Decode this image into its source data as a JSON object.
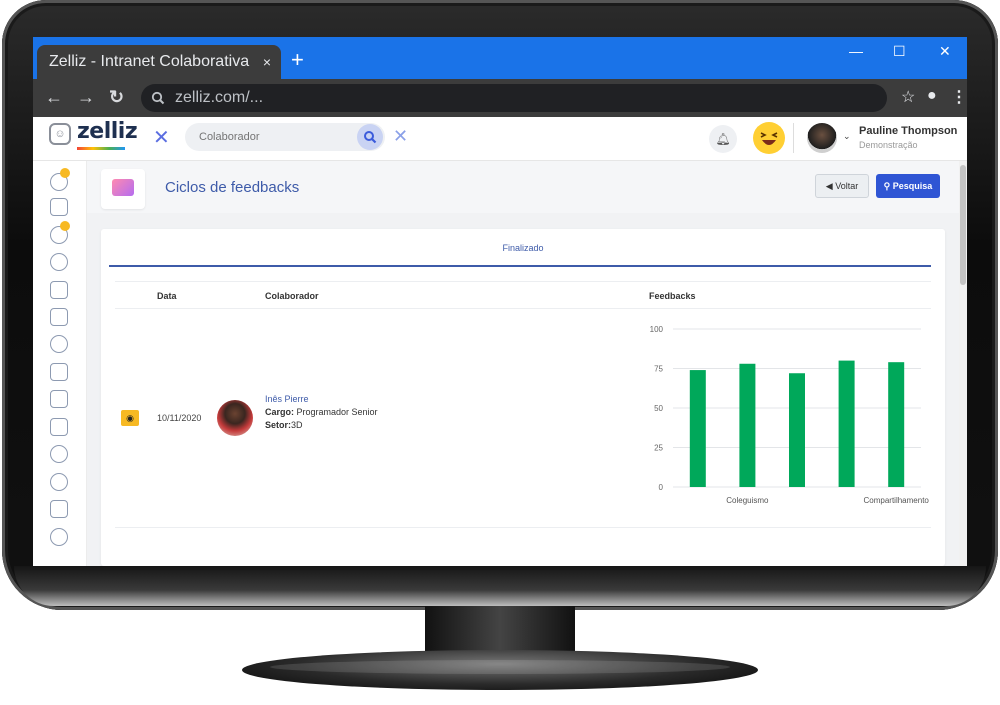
{
  "browser": {
    "tab_title": "Zelliz - Intranet Colaborativa",
    "tab_close": "×",
    "new_tab": "+",
    "url": "zelliz.com/...",
    "window_controls": [
      "—",
      "☐",
      "✕"
    ]
  },
  "app": {
    "logo_text": "zelliz",
    "search_placeholder": "Colaborador",
    "user": {
      "name": "Pauline Thompson",
      "role": "Demonstração"
    }
  },
  "sidebar": {
    "icons": [
      "team-icon",
      "certificate-icon",
      "chat-icon",
      "person-icon",
      "photo-icon",
      "presentation-icon",
      "trophy-icon",
      "book-icon",
      "notes-icon",
      "calendar-icon",
      "gamepad-icon",
      "location-icon",
      "document-icon",
      "handshake-icon"
    ],
    "badge_color": "#f7b923"
  },
  "page": {
    "title": "Ciclos de feedbacks",
    "back_label": "Voltar",
    "search_label": "Pesquisa"
  },
  "tabs": {
    "active": "Finalizado"
  },
  "table": {
    "headers": {
      "date": "Data",
      "collaborator": "Colaborador",
      "feedbacks": "Feedbacks"
    },
    "row": {
      "date": "10/11/2020",
      "name": "Inês Pierre",
      "cargo_label": "Cargo:",
      "cargo": "Programador Senior",
      "setor_label": "Setor:",
      "setor": "3D"
    }
  },
  "chart_data": {
    "type": "bar",
    "categories": [
      "",
      "Coleguismo",
      "",
      "",
      "Compartilhamento"
    ],
    "values": [
      74,
      78,
      72,
      80,
      79
    ],
    "ylim": [
      0,
      100
    ],
    "yticks": [
      0,
      25,
      50,
      75,
      100
    ],
    "grid": true,
    "color": "#00a85a"
  },
  "colors": {
    "brand_blue": "#1a73e8",
    "accent_blue": "#2f55d4",
    "accent_yellow": "#f7b923",
    "bar_green": "#00a85a"
  }
}
